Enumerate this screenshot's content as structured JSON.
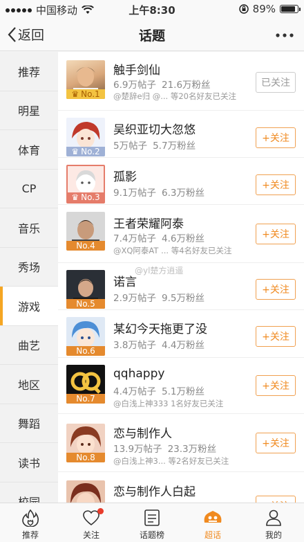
{
  "status_bar": {
    "carrier": "中国移动",
    "time": "上午8:30",
    "battery_pct": "89%"
  },
  "nav": {
    "back_label": "返回",
    "title": "话题"
  },
  "sidebar": {
    "items": [
      {
        "label": "推荐"
      },
      {
        "label": "明星"
      },
      {
        "label": "体育"
      },
      {
        "label": "CP"
      },
      {
        "label": "音乐"
      },
      {
        "label": "秀场"
      },
      {
        "label": "游戏",
        "active": true
      },
      {
        "label": "曲艺"
      },
      {
        "label": "地区"
      },
      {
        "label": "舞蹈"
      },
      {
        "label": "读书"
      },
      {
        "label": "校园"
      }
    ]
  },
  "topics": [
    {
      "name": "触手剑仙",
      "posts": "6.9万帖子",
      "fans": "21.6万粉丝",
      "friends": "@楚辞e归 @... 等20名好友已关注",
      "rank": "No.1",
      "button": "已关注",
      "followed": true
    },
    {
      "name": "吴织亚切大忽悠",
      "posts": "5万帖子",
      "fans": "5.7万粉丝",
      "friends": "",
      "rank": "No.2",
      "button": "+关注",
      "followed": false
    },
    {
      "name": "孤影",
      "posts": "9.1万帖子",
      "fans": "6.3万粉丝",
      "friends": "",
      "rank": "No.3",
      "button": "+关注",
      "followed": false
    },
    {
      "name": "王者荣耀阿泰",
      "posts": "7.4万帖子",
      "fans": "4.6万粉丝",
      "friends": "@XQ阿泰AT ... 等4名好友已关注",
      "rank": "No.4",
      "button": "+关注",
      "followed": false
    },
    {
      "name": "诺言",
      "posts": "2.9万帖子",
      "fans": "9.5万粉丝",
      "friends": "",
      "rank": "No.5",
      "button": "+关注",
      "followed": false
    },
    {
      "name": "某幻今天拖更了没",
      "posts": "3.8万帖子",
      "fans": "4.4万粉丝",
      "friends": "",
      "rank": "No.6",
      "button": "+关注",
      "followed": false
    },
    {
      "name": "qqhappy",
      "posts": "4.4万帖子",
      "fans": "5.1万粉丝",
      "friends": "@白浅上神333 1名好友已关注",
      "rank": "No.7",
      "button": "+关注",
      "followed": false
    },
    {
      "name": "恋与制作人",
      "posts": "13.9万帖子",
      "fans": "23.3万粉丝",
      "friends": "@白浅上神3... 等2名好友已关注",
      "rank": "No.8",
      "button": "+关注",
      "followed": false
    },
    {
      "name": "恋与制作人白起",
      "posts": "",
      "fans": "",
      "friends": "",
      "rank": "",
      "button": "+关注",
      "followed": false
    }
  ],
  "watermark": "@yl楚方逍遥",
  "tabs": [
    {
      "label": "推荐",
      "icon": "flame-icon"
    },
    {
      "label": "关注",
      "icon": "heart-icon",
      "badge": true
    },
    {
      "label": "话题榜",
      "icon": "list-icon"
    },
    {
      "label": "超话",
      "icon": "super-topic-icon",
      "active": true
    },
    {
      "label": "我的",
      "icon": "person-icon"
    }
  ]
}
